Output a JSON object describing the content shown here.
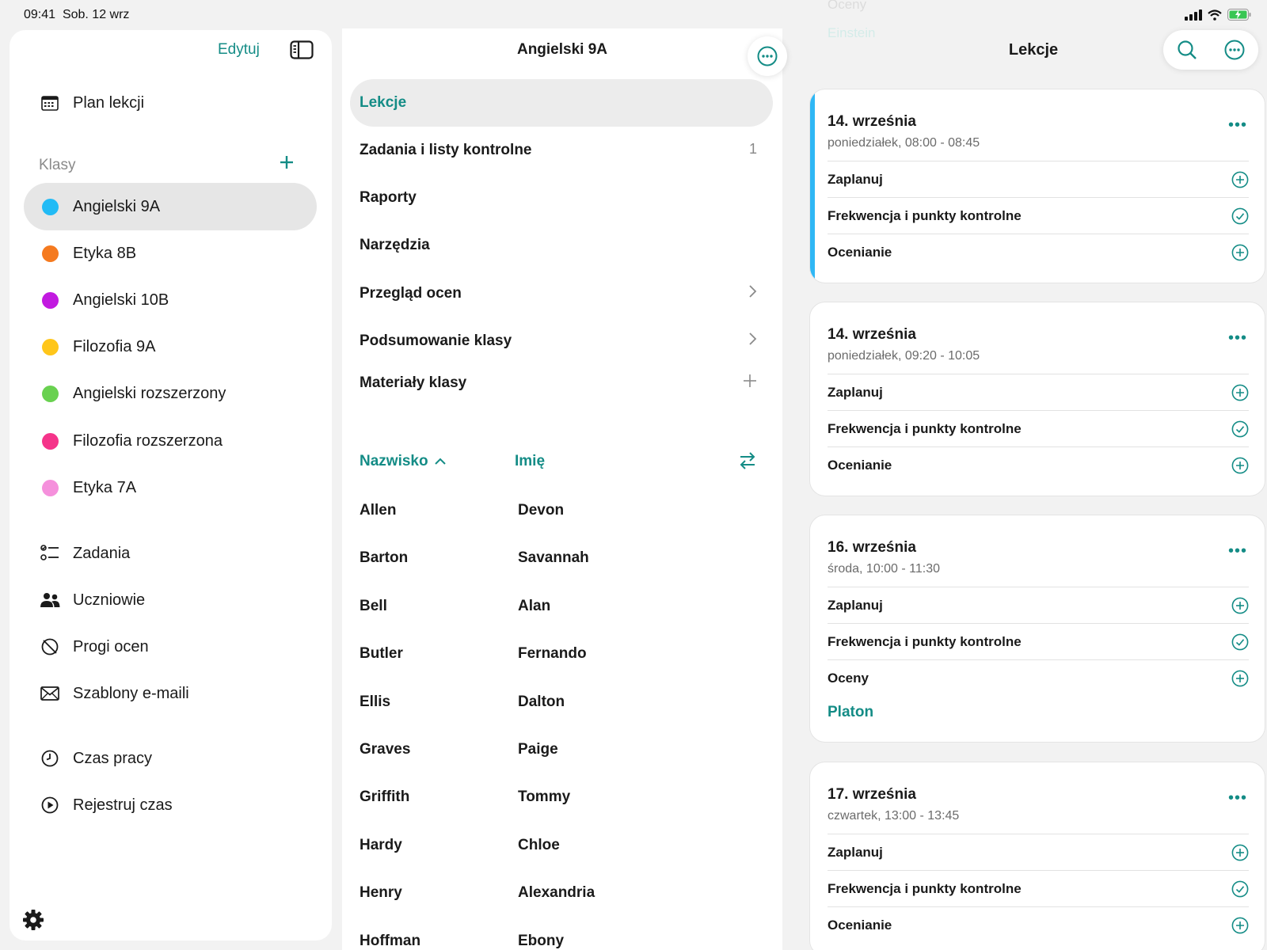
{
  "status": {
    "time": "09:41",
    "date": "Sob. 12 wrz"
  },
  "sidebar": {
    "edit_label": "Edytuj",
    "schedule_label": "Plan lekcji",
    "classes_header": "Klasy",
    "classes": [
      {
        "name": "Angielski 9A",
        "color": "#22bbf5",
        "selected": true
      },
      {
        "name": "Etyka 8B",
        "color": "#f57a1f"
      },
      {
        "name": "Angielski 10B",
        "color": "#c21ae0"
      },
      {
        "name": "Filozofia 9A",
        "color": "#ffc61a"
      },
      {
        "name": "Angielski rozszerzony",
        "color": "#69d150"
      },
      {
        "name": "Filozofia rozszerzona",
        "color": "#f5348a"
      },
      {
        "name": "Etyka 7A",
        "color": "#f590dc"
      }
    ],
    "tools": [
      {
        "label": "Zadania",
        "icon": "checklist-icon"
      },
      {
        "label": "Uczniowie",
        "icon": "people-icon"
      },
      {
        "label": "Progi ocen",
        "icon": "grade-thresholds-icon"
      },
      {
        "label": "Szablony e-maili",
        "icon": "envelope-icon"
      }
    ],
    "time": [
      {
        "label": "Czas pracy",
        "icon": "clock-icon"
      },
      {
        "label": "Rejestruj czas",
        "icon": "play-icon"
      }
    ]
  },
  "middle": {
    "title": "Angielski 9A",
    "menu": [
      {
        "label": "Lekcje",
        "selected": true,
        "trail": ""
      },
      {
        "label": "Zadania i listy kontrolne",
        "trail": "1"
      },
      {
        "label": "Raporty",
        "trail": ""
      },
      {
        "label": "Narzędzia",
        "trail": ""
      },
      {
        "label": "Przegląd ocen",
        "trail": "chevron"
      },
      {
        "label": "Podsumowanie klasy",
        "trail": "chevron"
      },
      {
        "label": "Materiały klasy",
        "trail": "plus"
      }
    ],
    "sort_last": "Nazwisko",
    "sort_first": "Imię",
    "students": [
      {
        "last": "Allen",
        "first": "Devon"
      },
      {
        "last": "Barton",
        "first": "Savannah"
      },
      {
        "last": "Bell",
        "first": "Alan"
      },
      {
        "last": "Butler",
        "first": "Fernando"
      },
      {
        "last": "Ellis",
        "first": "Dalton"
      },
      {
        "last": "Graves",
        "first": "Paige"
      },
      {
        "last": "Griffith",
        "first": "Tommy"
      },
      {
        "last": "Hardy",
        "first": "Chloe"
      },
      {
        "last": "Henry",
        "first": "Alexandria"
      },
      {
        "last": "Hoffman",
        "first": "Ebony"
      }
    ]
  },
  "right": {
    "title": "Lekcje",
    "ghost_top": "Oceny",
    "ghost_link": "Einstein",
    "lessons": [
      {
        "date": "14. września",
        "time": "poniedziałek, 08:00 - 08:45",
        "accent": true,
        "rows": [
          {
            "label": "Zaplanuj",
            "icon": "plus"
          },
          {
            "label": "Frekwencja i punkty kontrolne",
            "icon": "check"
          },
          {
            "label": "Ocenianie",
            "icon": "plus"
          }
        ],
        "link": ""
      },
      {
        "date": "14. września",
        "time": "poniedziałek, 09:20 - 10:05",
        "accent": false,
        "rows": [
          {
            "label": "Zaplanuj",
            "icon": "plus"
          },
          {
            "label": "Frekwencja i punkty kontrolne",
            "icon": "check"
          },
          {
            "label": "Ocenianie",
            "icon": "plus"
          }
        ],
        "link": ""
      },
      {
        "date": "16. września",
        "time": "środa, 10:00 - 11:30",
        "accent": false,
        "rows": [
          {
            "label": "Zaplanuj",
            "icon": "plus"
          },
          {
            "label": "Frekwencja i punkty kontrolne",
            "icon": "check"
          },
          {
            "label": "Oceny",
            "icon": "plus"
          }
        ],
        "link": "Platon"
      },
      {
        "date": "17. września",
        "time": "czwartek, 13:00 - 13:45",
        "accent": false,
        "rows": [
          {
            "label": "Zaplanuj",
            "icon": "plus"
          },
          {
            "label": "Frekwencja i punkty kontrolne",
            "icon": "check"
          },
          {
            "label": "Ocenianie",
            "icon": "plus"
          }
        ],
        "link": ""
      }
    ]
  }
}
